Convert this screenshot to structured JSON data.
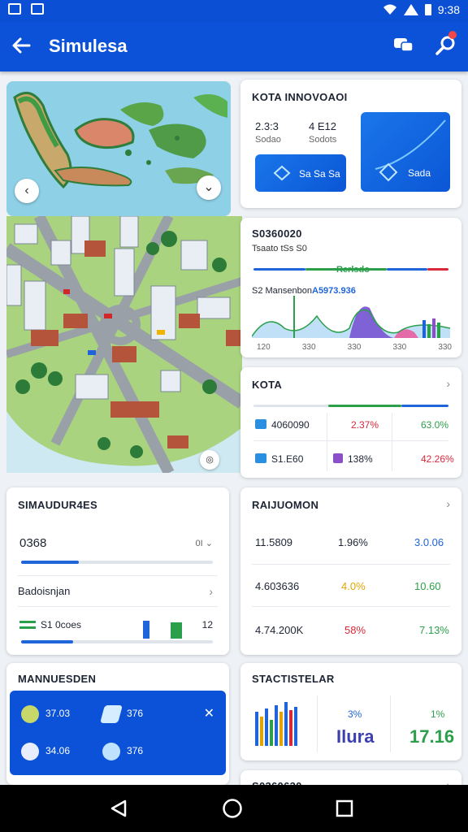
{
  "status": {
    "time": "9:38"
  },
  "appbar": {
    "title": "Simulesa"
  },
  "kota_innovation": {
    "title": "KOTA INNOVOAOI",
    "stat1_value": "2.3:3",
    "stat1_label": "Sodao",
    "stat2_value": "4 E12",
    "stat2_label": "Sodots",
    "btn1_label": "Sa Sa Sa",
    "btn2_label": "Sada"
  },
  "chart_card": {
    "title": "S0360020",
    "subtitle": "Tsaato tSs S0",
    "mini_label": "Rerlsdo",
    "line_label": "S2 Mansenbon",
    "line_value": "A5973.936",
    "tick_labels": [
      "120",
      "330",
      "330",
      "330",
      "330"
    ]
  },
  "kota": {
    "title": "KOTA",
    "row1": {
      "value": "4060090",
      "pct1": "2.37%",
      "pct2": "63.0%"
    },
    "row2": {
      "value": "S1.E60",
      "pct1": "138%",
      "pct2": "42.26%"
    }
  },
  "simulation": {
    "title": "SIMAUDUR4ES",
    "value": "0368",
    "unit": "0I",
    "slider1_fill": 0.3,
    "section2": "Badoisnjan",
    "bar_label": "S1 0coes",
    "bar_value": "12",
    "slider2_fill": 0.27
  },
  "ranking": {
    "title": "RAIJUOMON",
    "rows": [
      {
        "a": "11.5809",
        "b": "1.96%",
        "c": "3.0.06"
      },
      {
        "a": "4.603636",
        "b": "4.0%",
        "c": "10.60"
      },
      {
        "a": "4.74.200K",
        "b": "58%",
        "c": "7.13%"
      }
    ]
  },
  "manuesden": {
    "title": "MANNUESDEN",
    "item1": "37.03",
    "item2": "376",
    "item3": "34.06",
    "item4": "376"
  },
  "statistics": {
    "title": "STACTISTELAR",
    "pct1": "3%",
    "label1": "Ilura",
    "pct2": "1%",
    "value2": "17.16"
  },
  "footer_card": {
    "title": "S0360630"
  },
  "colors": {
    "primary": "#0b52d8",
    "green": "#2c9f4b",
    "red": "#d8283a",
    "amber": "#e2a400",
    "purple": "#8b4fc8"
  },
  "icons": {
    "back": "arrow-left-icon",
    "chat": "chat-icon",
    "search": "search-icon",
    "map_left": "chevron-left-icon",
    "map_expand": "chevron-down-icon"
  }
}
